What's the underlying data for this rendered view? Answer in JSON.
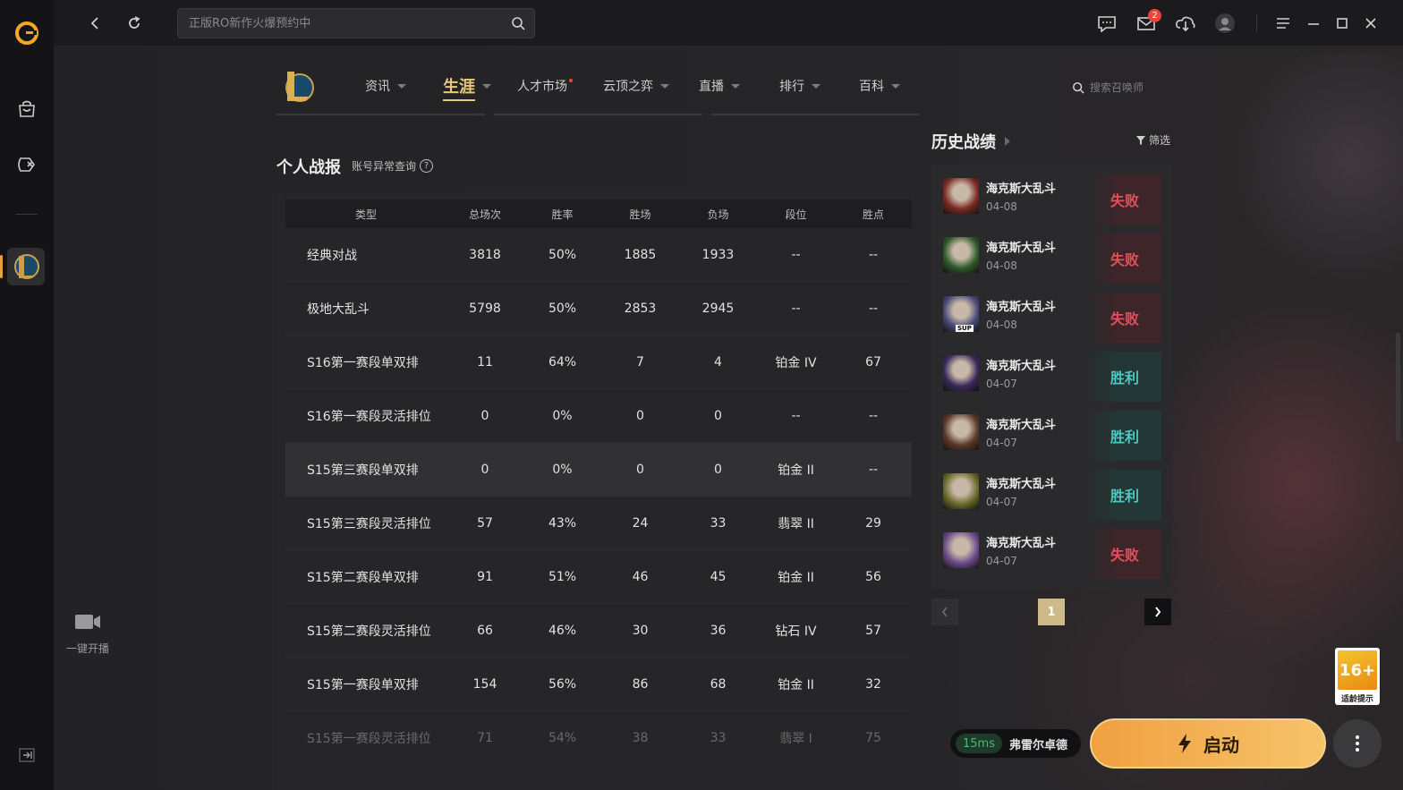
{
  "topbar": {
    "search_placeholder": "正版RO新作火爆预约中",
    "mail_badge": "2"
  },
  "sidebar": {
    "live_label": "一键开播"
  },
  "game_nav": {
    "items": [
      {
        "label": "资讯"
      },
      {
        "label": "生涯"
      },
      {
        "label": "人才市场"
      },
      {
        "label": "云顶之弈"
      },
      {
        "label": "直播"
      },
      {
        "label": "排行"
      },
      {
        "label": "百科"
      }
    ],
    "summoner_search_placeholder": "搜索召唤师"
  },
  "stats": {
    "title": "个人战报",
    "link": "账号异常查询",
    "headers": [
      "类型",
      "总场次",
      "胜率",
      "胜场",
      "负场",
      "段位",
      "胜点"
    ],
    "rows": [
      [
        "经典对战",
        "3818",
        "50%",
        "1885",
        "1933",
        "--",
        "--"
      ],
      [
        "极地大乱斗",
        "5798",
        "50%",
        "2853",
        "2945",
        "--",
        "--"
      ],
      [
        "S16第一赛段单双排",
        "11",
        "64%",
        "7",
        "4",
        "铂金 IV",
        "67"
      ],
      [
        "S16第一赛段灵活排位",
        "0",
        "0%",
        "0",
        "0",
        "--",
        "--"
      ],
      [
        "S15第三赛段单双排",
        "0",
        "0%",
        "0",
        "0",
        "铂金 II",
        "--"
      ],
      [
        "S15第三赛段灵活排位",
        "57",
        "43%",
        "24",
        "33",
        "翡翠 II",
        "29"
      ],
      [
        "S15第二赛段单双排",
        "91",
        "51%",
        "46",
        "45",
        "铂金 II",
        "56"
      ],
      [
        "S15第二赛段灵活排位",
        "66",
        "46%",
        "30",
        "36",
        "钻石 IV",
        "57"
      ],
      [
        "S15第一赛段单双排",
        "154",
        "56%",
        "86",
        "68",
        "铂金 II",
        "32"
      ],
      [
        "S15第一赛段灵活排位",
        "71",
        "54%",
        "38",
        "33",
        "翡翠 I",
        "75"
      ]
    ]
  },
  "history": {
    "title": "历史战绩",
    "filter_label": "筛选",
    "matches": [
      {
        "mode": "海克斯大乱斗",
        "date": "04-08",
        "result": "失败",
        "win": false,
        "color": "#7a2a22"
      },
      {
        "mode": "海克斯大乱斗",
        "date": "04-08",
        "result": "失败",
        "win": false,
        "color": "#2e5a2a"
      },
      {
        "mode": "海克斯大乱斗",
        "date": "04-08",
        "result": "失败",
        "win": false,
        "color": "#4a4a7a",
        "tag": "SUP"
      },
      {
        "mode": "海克斯大乱斗",
        "date": "04-07",
        "result": "胜利",
        "win": true,
        "color": "#3a2a5a"
      },
      {
        "mode": "海克斯大乱斗",
        "date": "04-07",
        "result": "胜利",
        "win": true,
        "color": "#5a3a2a"
      },
      {
        "mode": "海克斯大乱斗",
        "date": "04-07",
        "result": "胜利",
        "win": true,
        "color": "#6a6a2a"
      },
      {
        "mode": "海克斯大乱斗",
        "date": "04-07",
        "result": "失败",
        "win": false,
        "color": "#6a4a8a"
      }
    ],
    "page": "1"
  },
  "age_rating": {
    "rating": "16+",
    "label": "适龄提示"
  },
  "bottom": {
    "ping": "15ms",
    "server": "弗雷尔卓德",
    "launch_label": "启动"
  },
  "colors": {
    "accent": "#e9c77a",
    "win": "#4cc9c0",
    "lose": "#e2505a",
    "launch": "#f0a040"
  }
}
